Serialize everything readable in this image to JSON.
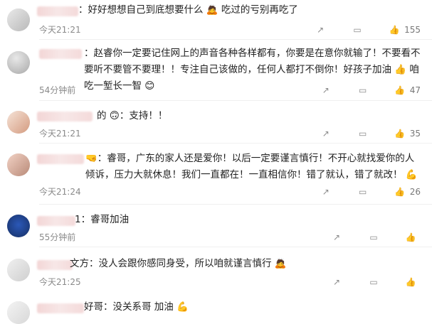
{
  "comments": [
    {
      "text": "：好好想想自己到底想要什么 🙇 吃过的亏别再吃了",
      "time": "今天21:21",
      "likes": "155"
    },
    {
      "text": "：赵睿你一定要记住网上的声音各种各样都有，你要是在意你就输了！不要看不要听不要管不要理！！专注自己该做的，任何人都打不倒你！好孩子加油 👍 咱吃一堑长一智 😊",
      "time": "54分钟前",
      "likes": "47"
    },
    {
      "text": "的 🙃：支持！！",
      "time": "今天21:21",
      "likes": "35"
    },
    {
      "text": "🤜：睿哥，广东的家人还是爱你！以后一定要谨言慎行！不开心就找爱你的人倾诉，压力大就休息！我们一直都在！一直相信你！错了就认，错了就改！ 💪",
      "time": "今天21:24",
      "likes": "26"
    },
    {
      "text": "1：睿哥加油",
      "time": "55分钟前",
      "likes": ""
    },
    {
      "text": "文方：没人会跟你感同身受，所以咱就谨言慎行 🙇",
      "time": "今天21:25",
      "likes": ""
    },
    {
      "text": "好哥：没关系哥 加油 💪",
      "time": "",
      "likes": ""
    }
  ],
  "icons": {
    "share": "share-icon",
    "comment": "comment-icon",
    "like": "thumb-up-icon"
  },
  "colors": {
    "name_blur": "#f4dada",
    "time": "#8a8a8a"
  }
}
